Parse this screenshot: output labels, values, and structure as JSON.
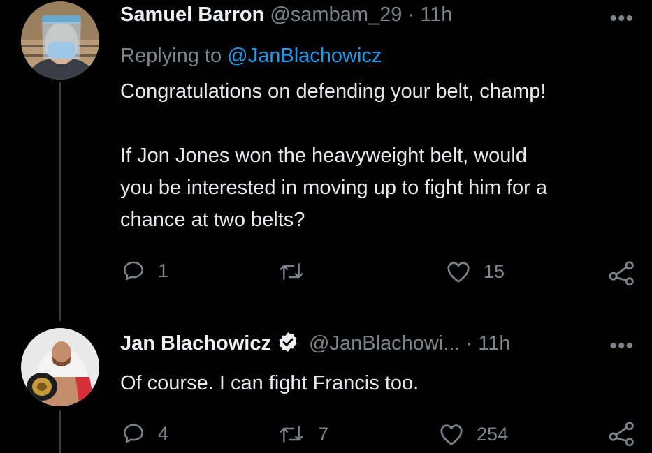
{
  "tweet1": {
    "name": "Samuel Barron",
    "handle": "@sambam_29",
    "separator": "·",
    "time": "11h",
    "more": "•••",
    "replying_prefix": "Replying to",
    "replying_to": "@JanBlachowicz",
    "text_line1": "Congratulations on defending your belt, champ!",
    "text_line2": "If Jon Jones won the heavyweight belt, would",
    "text_line3": "you be interested in moving up to fight him for a",
    "text_line4": "chance at two belts?",
    "replies": "1",
    "retweets": "",
    "likes": "15"
  },
  "tweet2": {
    "name": "Jan Blachowicz",
    "handle": "@JanBlachowi...",
    "separator": "·",
    "time": "11h",
    "more": "•••",
    "text": "Of course. I can fight Francis too.",
    "replies": "4",
    "retweets": "7",
    "likes": "254"
  },
  "icons": {
    "reply": "reply-icon",
    "retweet": "retweet-icon",
    "like": "heart-icon",
    "share": "share-icon",
    "verified": "verified-badge-icon"
  },
  "colors": {
    "background": "#000000",
    "text": "#e7e9ea",
    "muted": "#7b8489",
    "link": "#1d9bf0"
  }
}
